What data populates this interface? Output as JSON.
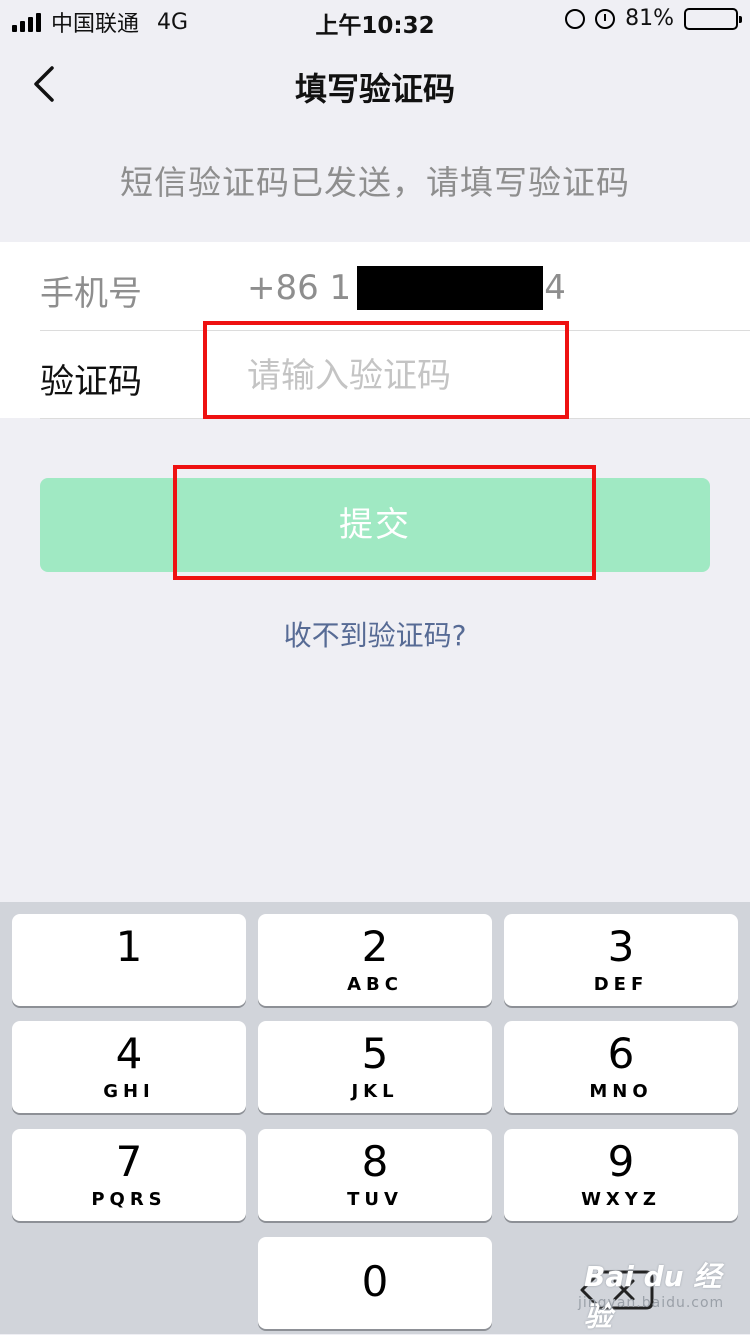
{
  "status_bar": {
    "carrier": "中国联通",
    "network": "4G",
    "time": "上午10:32",
    "battery": "81%",
    "battery_level": 0.81
  },
  "nav": {
    "title": "填写验证码"
  },
  "hint": "短信验证码已发送，请填写验证码",
  "form": {
    "phone_label": "手机号",
    "phone_prefix": "+86 1",
    "phone_suffix": "4",
    "code_label": "验证码",
    "code_placeholder": "请输入验证码",
    "code_value": ""
  },
  "submit_label": "提交",
  "help_link": "收不到验证码?",
  "keyboard": {
    "keys": [
      {
        "num": "1",
        "letters": ""
      },
      {
        "num": "2",
        "letters": "ABC"
      },
      {
        "num": "3",
        "letters": "DEF"
      },
      {
        "num": "4",
        "letters": "GHI"
      },
      {
        "num": "5",
        "letters": "JKL"
      },
      {
        "num": "6",
        "letters": "MNO"
      },
      {
        "num": "7",
        "letters": "PQRS"
      },
      {
        "num": "8",
        "letters": "TUV"
      },
      {
        "num": "9",
        "letters": "WXYZ"
      },
      {
        "num": "0",
        "letters": ""
      }
    ]
  },
  "watermark": {
    "brand": "Bai du 经验",
    "url": "jingyan.baidu.com"
  },
  "colors": {
    "accent_disabled": "#a0e9c3",
    "link": "#576b95",
    "highlight": "#ee1111"
  }
}
